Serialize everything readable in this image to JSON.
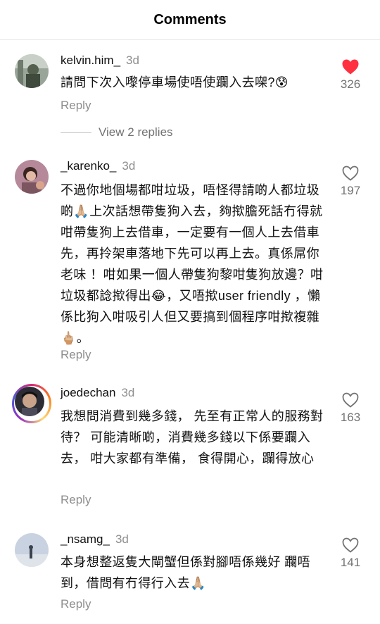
{
  "header": {
    "title": "Comments"
  },
  "comments": [
    {
      "username": "kelvin.him_",
      "time": "3d",
      "text": "請問下次入嚟停車場使唔使躝入去㗎?😰",
      "reply_label": "Reply",
      "likes": "326",
      "liked": true,
      "view_replies": "View 2 replies"
    },
    {
      "username": "_karenko_",
      "time": "3d",
      "text": "不過你地個場都咁垃圾，唔怪得請啲人都垃圾啲🙏🏼上次話想帶隻狗入去，夠揿膽死話冇得就咁帶隻狗上去借車，一定要有一個人上去借車先，再拎架車落地下先可以再上去。真係屌你老味 ！咁如果一個人帶隻狗黎咁隻狗放邊？咁垃圾都諗揿得出😂，又唔揿user friendly ，懶係比狗入咁吸引人但又要搞到個程序咁揿複雜🖕🏼。",
      "reply_label": "Reply",
      "likes": "197",
      "liked": false
    },
    {
      "username": "joedechan",
      "time": "3d",
      "text": "我想問消費到幾多錢， 先至有正常人的服務對待？ 可能清晰啲，消費幾多錢以下係要躝入去， 咁大家都有準備， 食得開心，躝得放心",
      "reply_label": "Reply",
      "likes": "163",
      "liked": false
    },
    {
      "username": "_nsamg_",
      "time": "3d",
      "text": "本身想整返隻大閘蟹但係對腳唔係幾好 躝唔到，借問有冇得行入去🙏🏼",
      "reply_label": "Reply",
      "likes": "141",
      "liked": false
    }
  ],
  "colors": {
    "liked_heart": "#ff3040",
    "secondary_text": "#8e8e8e"
  },
  "icons": [
    "heart-filled-icon",
    "heart-outline-icon"
  ]
}
